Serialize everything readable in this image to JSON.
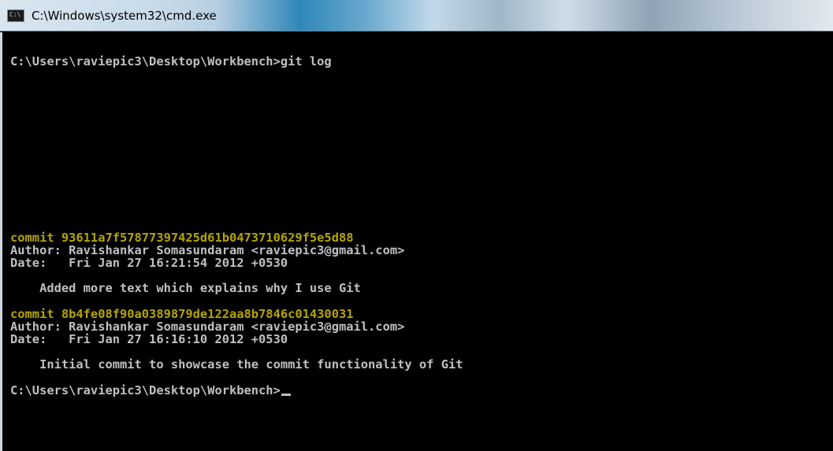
{
  "window": {
    "title": "C:\\Windows\\system32\\cmd.exe",
    "icon": "cmd-icon"
  },
  "console": {
    "prompt_command": "C:\\Users\\raviepic3\\Desktop\\Workbench>git log",
    "commits": [
      {
        "commit_line": "commit 93611a7f57877397425d61b0473710629f5e5d88",
        "author_line": "Author: Ravishankar Somasundaram <raviepic3@gmail.com>",
        "date_line": "Date:   Fri Jan 27 16:21:54 2012 +0530",
        "message_line": "    Added more text which explains why I use Git"
      },
      {
        "commit_line": "commit 8b4fe08f90a0389879de122aa8b7846c01430031",
        "author_line": "Author: Ravishankar Somasundaram <raviepic3@gmail.com>",
        "date_line": "Date:   Fri Jan 27 16:16:10 2012 +0530",
        "message_line": "    Initial commit to showcase the commit functionality of Git"
      }
    ],
    "final_prompt": "C:\\Users\\raviepic3\\Desktop\\Workbench>"
  },
  "colors": {
    "background": "#000000",
    "text": "#c0c0c0",
    "commit_hash": "#b5a500"
  }
}
